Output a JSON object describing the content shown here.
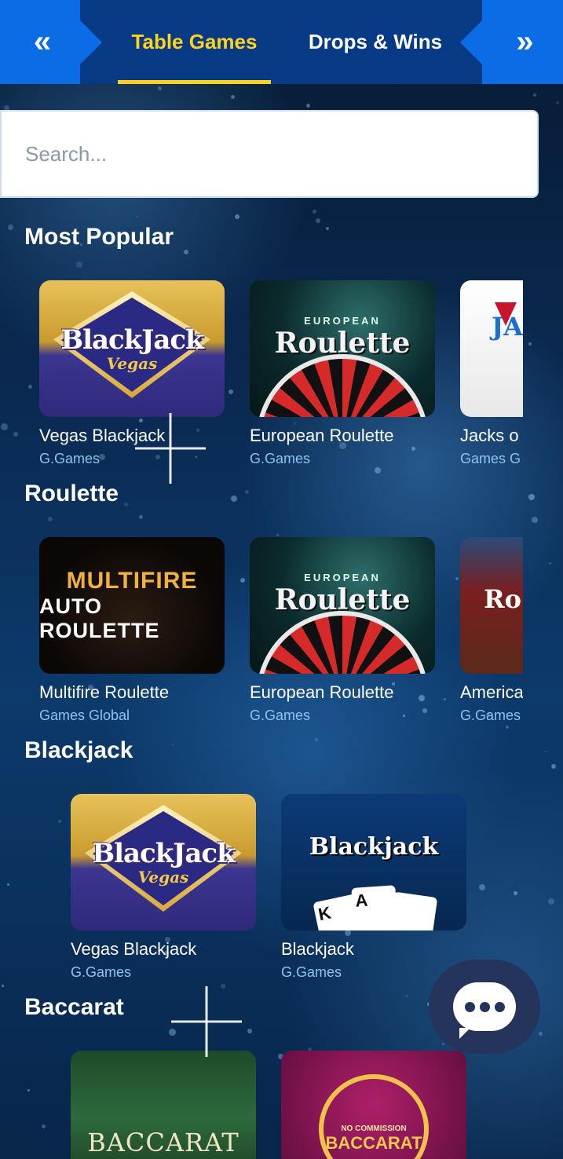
{
  "nav": {
    "prev_icon": "«",
    "next_icon": "»",
    "tabs": [
      {
        "label": "Table Games",
        "active": true
      },
      {
        "label": "Drops & Wins",
        "active": false
      }
    ],
    "active_color": "#ffd21f"
  },
  "search": {
    "placeholder": "Search..."
  },
  "sections": [
    {
      "title": "Most Popular",
      "games": [
        {
          "name": "Vegas Blackjack",
          "provider": "G.Games",
          "art": "BlackJack",
          "art_sub": "Vegas"
        },
        {
          "name": "European Roulette",
          "provider": "G.Games",
          "art_top": "EUROPEAN",
          "art": "Roulette"
        },
        {
          "name": "Jacks o",
          "provider": "Games G",
          "art": "JAC"
        }
      ]
    },
    {
      "title": "Roulette",
      "games": [
        {
          "name": "Multifire Roulette",
          "provider": "Games Global",
          "art": "MULTIFIRE",
          "art_sub": "AUTO ROULETTE"
        },
        {
          "name": "European Roulette",
          "provider": "G.Games",
          "art_top": "EUROPEAN",
          "art": "Roulette"
        },
        {
          "name": "America",
          "provider": "G.Games",
          "art": "Ro"
        }
      ]
    },
    {
      "title": "Blackjack",
      "games": [
        {
          "name": "Vegas Blackjack",
          "provider": "G.Games",
          "art": "BlackJack",
          "art_sub": "Vegas"
        },
        {
          "name": "Blackjack",
          "provider": "G.Games",
          "art": "Blackjack"
        }
      ]
    },
    {
      "title": "Baccarat",
      "games": [
        {
          "name": "",
          "provider": "",
          "art": "BACCARAT"
        },
        {
          "name": "",
          "provider": "",
          "art_top": "NO COMMISSION",
          "art": "BACCARAT"
        }
      ]
    }
  ],
  "chat": {
    "icon": "chat-bubble-icon"
  }
}
